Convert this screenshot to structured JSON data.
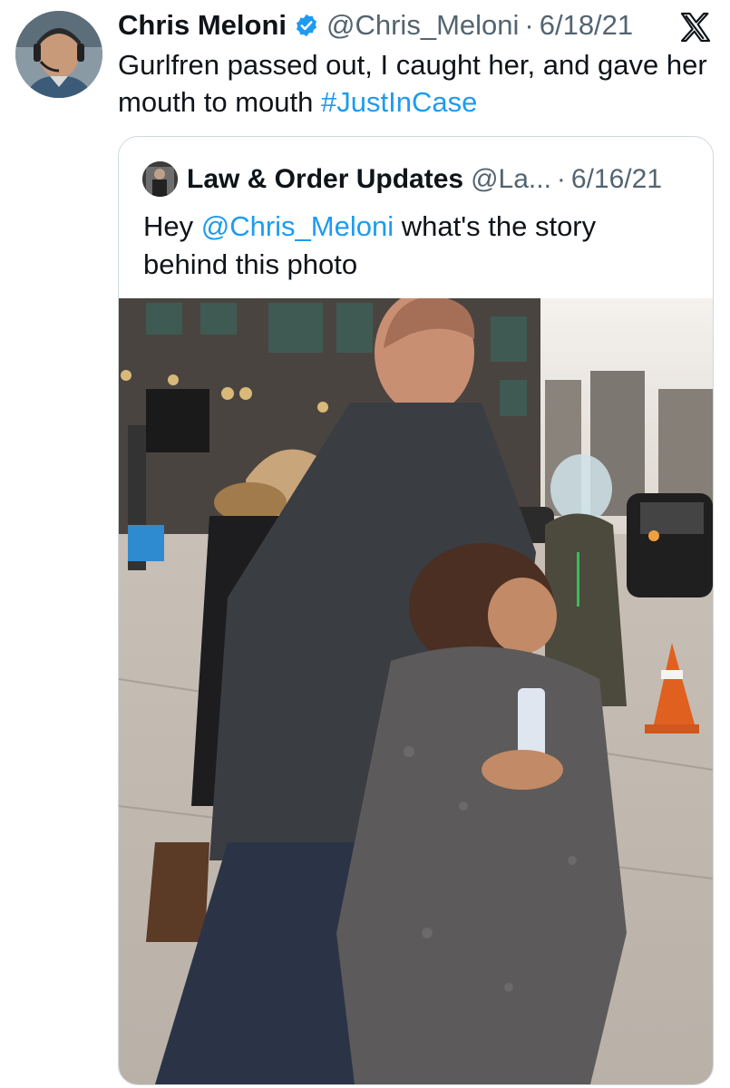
{
  "tweet": {
    "author_name": "Chris Meloni",
    "handle": "@Chris_Meloni",
    "separator": "·",
    "date": "6/18/21",
    "text_main": "Gurlfren passed out, I caught her, and gave her mouth to mouth ",
    "hashtag": "#JustInCase",
    "verified_icon": "verified-badge-icon",
    "x_logo_icon": "x-logo-icon"
  },
  "quoted_tweet": {
    "author_name": "Law & Order Updates",
    "handle": "@La...",
    "separator": "·",
    "date": "6/16/21",
    "text_before": "Hey ",
    "mention": "@Chris_Meloni",
    "text_after": " what's the story behind this photo",
    "photo": "photo-of-two-actors-on-city-street-set"
  },
  "colors": {
    "link": "#1d9bf0",
    "text": "#0f1419",
    "secondary": "#536471",
    "border": "#cfd9de",
    "verified": "#1d9bf0"
  }
}
